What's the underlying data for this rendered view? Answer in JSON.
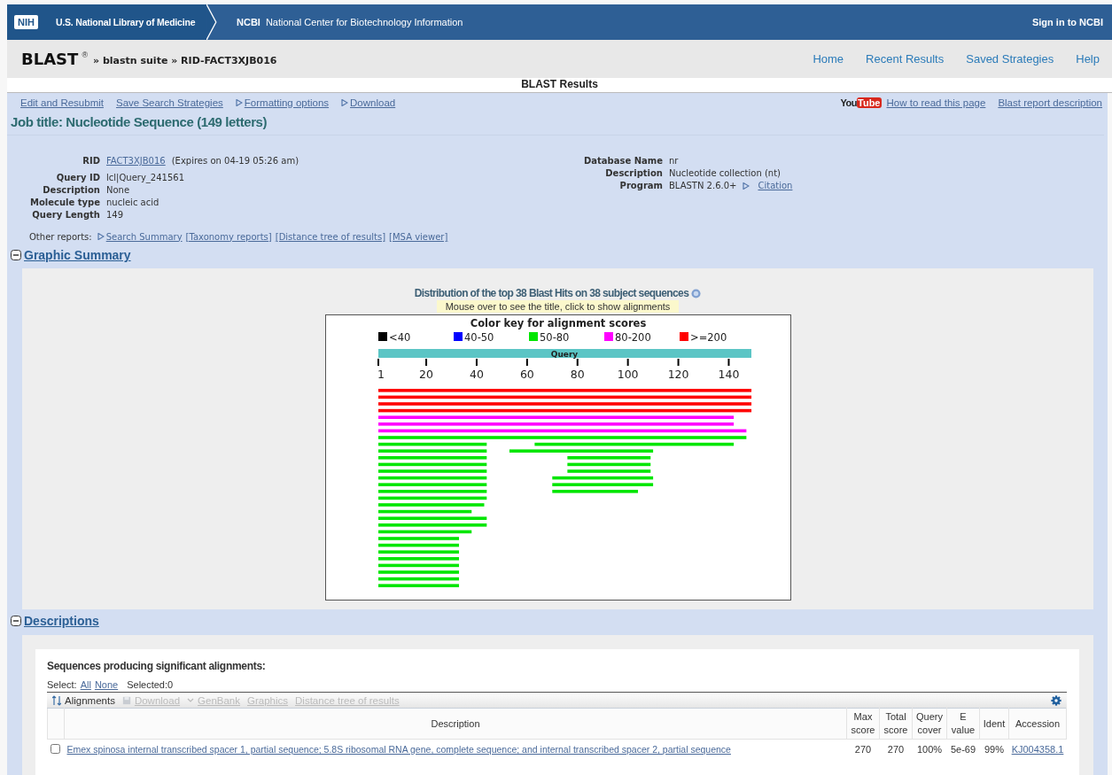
{
  "top_bar": {
    "nih_logo": "NIH",
    "library": "U.S. National Library of Medicine",
    "ncbi_short": "NCBI",
    "ncbi_full": "National Center for Biotechnology Information",
    "sign_in": "Sign in to NCBI"
  },
  "header": {
    "brand": "BLAST",
    "reg": "®",
    "path": "» blastn suite » RID-FACT3XJB016",
    "nav": [
      "Home",
      "Recent Results",
      "Saved Strategies",
      "Help"
    ]
  },
  "page_title": "BLAST Results",
  "toolbar": {
    "links": [
      {
        "label": "Edit and Resubmit",
        "marker": false
      },
      {
        "label": "Save Search Strategies",
        "marker": false
      },
      {
        "label": "Formatting options",
        "marker": true
      },
      {
        "label": "Download",
        "marker": true
      }
    ],
    "youtube_logo": [
      "You",
      "Tube"
    ],
    "help_links": [
      "How to read this page",
      "Blast report description"
    ]
  },
  "job_title": "Job title: Nucleotide Sequence (149 letters)",
  "details_left": [
    {
      "label": "RID",
      "link": "FACT3XJB016",
      "value": "(Expires on 04-19 05:26 am)"
    },
    {
      "label": "Query ID",
      "value": "lcl|Query_241561"
    },
    {
      "label": "Description",
      "value": "None"
    },
    {
      "label": "Molecule type",
      "value": "nucleic acid"
    },
    {
      "label": "Query Length",
      "value": "149"
    }
  ],
  "details_right": [
    {
      "label": "Database Name",
      "value": "nr"
    },
    {
      "label": "Description",
      "value": "Nucleotide collection (nt)"
    },
    {
      "label": "Program",
      "value": "BLASTN 2.6.0+",
      "link": "Citation"
    }
  ],
  "other_reports": {
    "label": "Other reports:",
    "links": [
      {
        "label": "Search Summary",
        "marker": true
      },
      {
        "label": "[Taxonomy reports]",
        "marker": false
      },
      {
        "label": "[Distance tree of results]",
        "marker": false
      },
      {
        "label": "[MSA viewer]",
        "marker": false
      }
    ]
  },
  "graphic_summary": {
    "heading": "Graphic Summary",
    "expanded": true,
    "title": "Distribution of the top 38 Blast Hits on 38 subject sequences",
    "hint": "Mouse over to see the title, click to show alignments",
    "key_title": "Color key for alignment scores",
    "key": [
      {
        "label": "<40",
        "color": "#000000"
      },
      {
        "label": "40-50",
        "color": "#0000ff"
      },
      {
        "label": "50-80",
        "color": "#00e600"
      },
      {
        "label": "80-200",
        "color": "#ff00ff"
      },
      {
        "label": ">=200",
        "color": "#ff0000"
      }
    ],
    "query_label": "Query",
    "ticks": [
      "1",
      "20",
      "40",
      "60",
      "80",
      "100",
      "120",
      "140"
    ]
  },
  "descriptions": {
    "heading": "Descriptions",
    "expanded": true,
    "caption": "Sequences producing significant alignments:",
    "select_label": "Select:",
    "select_links": [
      "All",
      "None"
    ],
    "selected": "Selected:0",
    "tools": [
      {
        "label": "Alignments",
        "disabled": false
      },
      {
        "label": "Download",
        "disabled": true
      },
      {
        "label": "GenBank",
        "disabled": true
      },
      {
        "label": "Graphics",
        "disabled": true
      },
      {
        "label": "Distance tree of results",
        "disabled": true
      }
    ],
    "columns": [
      "Description",
      "Max score",
      "Total score",
      "Query cover",
      "E value",
      "Ident",
      "Accession"
    ],
    "rows": [
      {
        "checked": false,
        "description": "Emex spinosa internal transcribed spacer 1, partial sequence; 5.8S ribosomal RNA gene, complete sequence; and internal transcribed spacer 2, partial sequence",
        "max_score": "270",
        "total_score": "270",
        "query_cover": "100%",
        "e_value": "5e-69",
        "ident": "99%",
        "accession": "KJ004358.1"
      }
    ]
  }
}
